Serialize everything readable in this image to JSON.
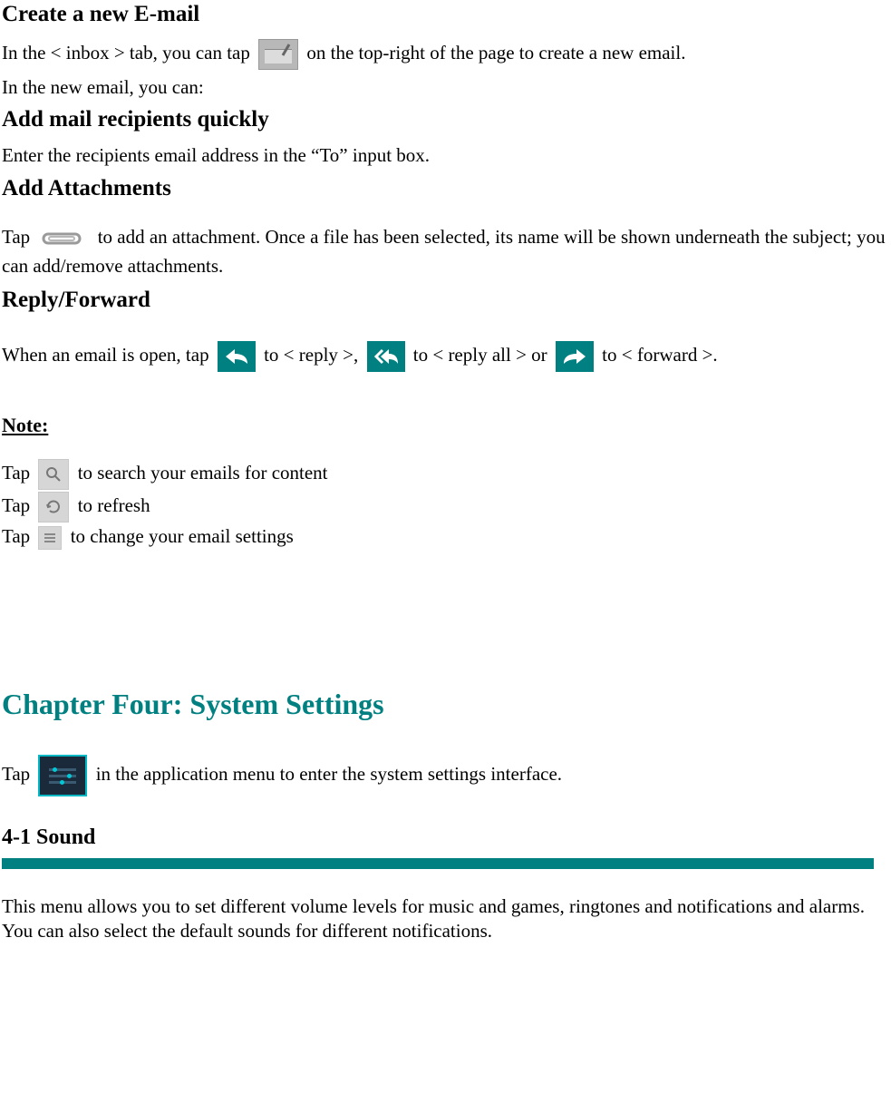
{
  "sec1": {
    "heading": "Create a new E-mail",
    "p1a": "In the < inbox > tab, you can tap ",
    "p1b": " on the top-right of the page to create a new email.",
    "p2": "In the new email, you can:"
  },
  "sec2": {
    "heading": "Add mail recipients quickly",
    "p1": "Enter the recipients email address in the “To” input box."
  },
  "sec3": {
    "heading": "Add Attachments",
    "p1a": "Tap ",
    "p1b": " to add an attachment. Once a file has been selected, its name will be shown underneath the subject; you can add/remove attachments."
  },
  "sec4": {
    "heading": "Reply/Forward",
    "p1a": "When an email is open, tap ",
    "p1b": " to < reply >, ",
    "p1c": " to < reply all > or ",
    "p1d": " to < forward >."
  },
  "note": {
    "heading": "Note:",
    "l1a": "Tap ",
    "l1b": " to search your emails for content",
    "l2a": "Tap ",
    "l2b": " to refresh",
    "l3a": "Tap ",
    "l3b": " to change your email settings"
  },
  "chapter": {
    "heading": "Chapter Four: System Settings",
    "p1a": "Tap ",
    "p1b": " in the application menu to enter the system settings interface."
  },
  "s41": {
    "heading": "4-1 Sound",
    "p1": "This menu allows you to set different volume levels for music and games, ringtones and notifications and alarms.    You can also select the default sounds for different notifications."
  }
}
